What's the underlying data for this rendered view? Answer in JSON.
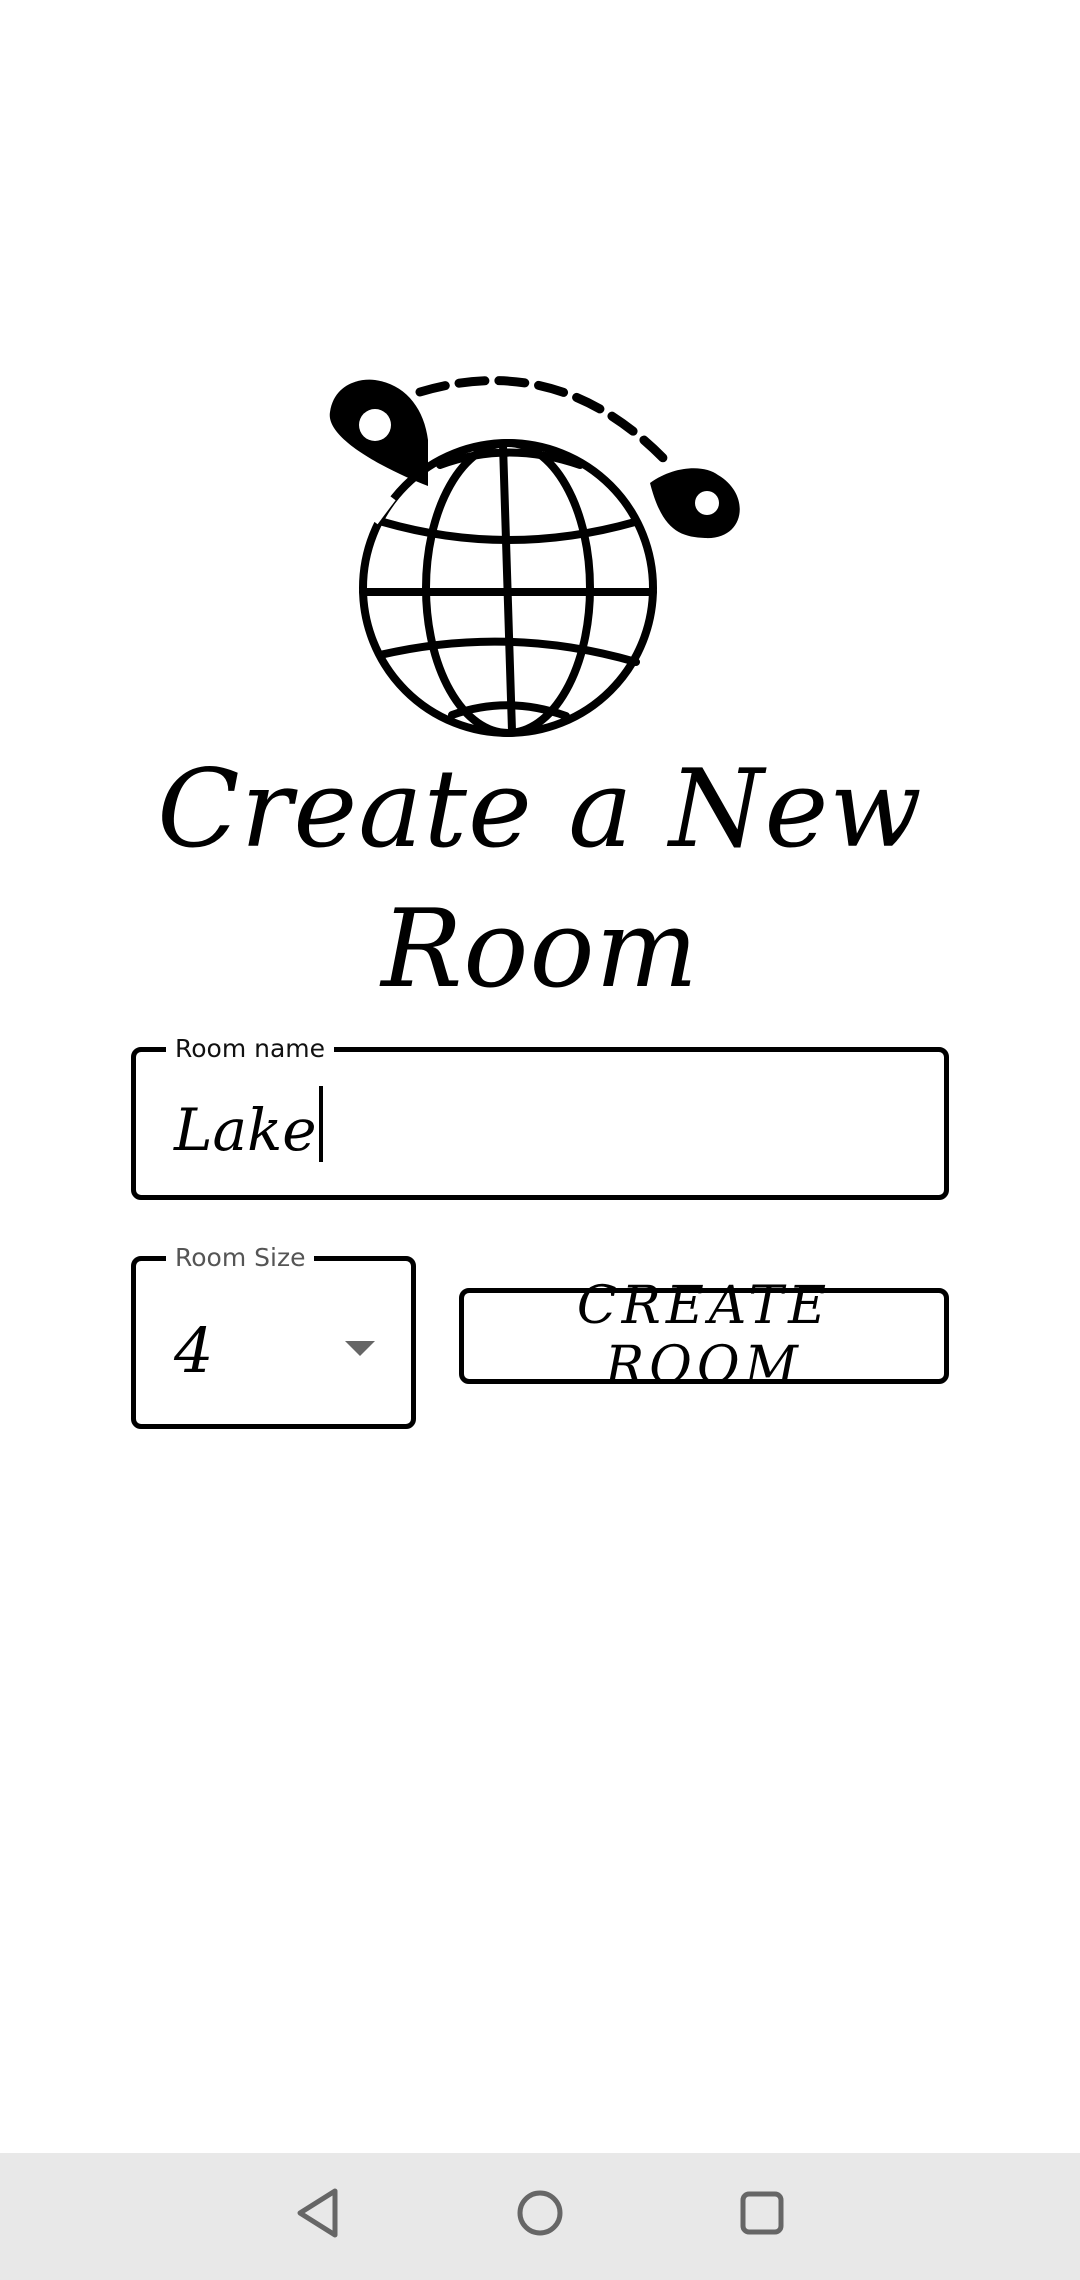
{
  "header": {
    "logo_icon": "globe-with-location-pins-icon",
    "title": "Create a New Room"
  },
  "form": {
    "room_name": {
      "label": "Room name",
      "value": "Lake"
    },
    "room_size": {
      "label": "Room Size",
      "value": "4",
      "icon": "caret-down-icon"
    },
    "create_button_label": "CREATE ROOM"
  },
  "nav_bar": {
    "back_icon": "back-triangle-icon",
    "home_icon": "home-circle-icon",
    "recents_icon": "recents-square-icon"
  },
  "colors": {
    "background": "#ffffff",
    "foreground": "#000000",
    "nav_bar": "#e8e8e8",
    "nav_icon": "#666666"
  }
}
